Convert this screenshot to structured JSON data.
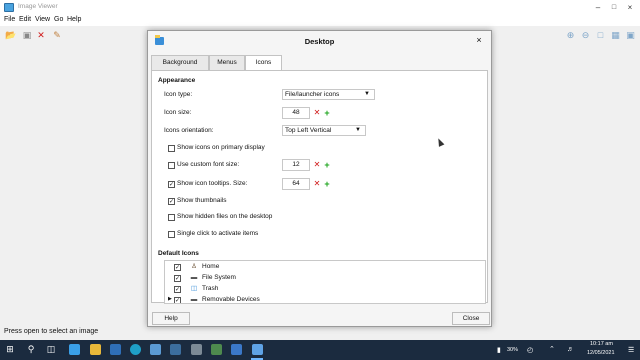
{
  "app": {
    "title": "Image Viewer",
    "menu": [
      "File",
      "Edit",
      "View",
      "Go",
      "Help"
    ],
    "status": "Press open to select an image",
    "window_controls": {
      "minimize": "–",
      "maximize": "□",
      "close": "×"
    }
  },
  "dialog": {
    "title": "Desktop",
    "close_glyph": "×",
    "tabs": [
      {
        "label": "Background"
      },
      {
        "label": "Menus"
      },
      {
        "label": "Icons",
        "active": true
      }
    ],
    "appearance": {
      "heading": "Appearance",
      "icon_type": {
        "label": "Icon type:",
        "value": "File/launcher icons"
      },
      "icon_size": {
        "label": "Icon size:",
        "value": "48"
      },
      "icons_orientation": {
        "label": "Icons orientation:",
        "value": "Top Left Vertical"
      },
      "show_on_primary": {
        "label": "Show icons on primary display",
        "checked": false
      },
      "custom_font_size": {
        "label": "Use custom font size:",
        "checked": false,
        "value": "12"
      },
      "icon_tooltips": {
        "label": "Show icon tooltips. Size:",
        "checked": true,
        "value": "64"
      },
      "show_thumbnails": {
        "label": "Show thumbnails",
        "checked": true
      },
      "show_hidden": {
        "label": "Show hidden files on the desktop",
        "checked": false
      },
      "single_click": {
        "label": "Single click to activate items",
        "checked": false
      }
    },
    "default_icons": {
      "heading": "Default Icons",
      "items": [
        {
          "label": "Home",
          "checked": true,
          "icon": "home-icon"
        },
        {
          "label": "File System",
          "checked": true,
          "icon": "drive-icon"
        },
        {
          "label": "Trash",
          "checked": true,
          "icon": "trash-icon"
        },
        {
          "label": "Removable Devices",
          "checked": true,
          "icon": "removable-drive-icon",
          "expandable": true
        }
      ]
    },
    "buttons": {
      "help": "Help",
      "close": "Close"
    }
  },
  "taskbar": {
    "battery": "30%",
    "time": "10:17 am",
    "date": "12/05/2021"
  },
  "colors": {
    "taskbar": "#1b2b3f",
    "minus": "#d01a1a",
    "plus": "#19a319",
    "accent": "#3a8fd8"
  }
}
